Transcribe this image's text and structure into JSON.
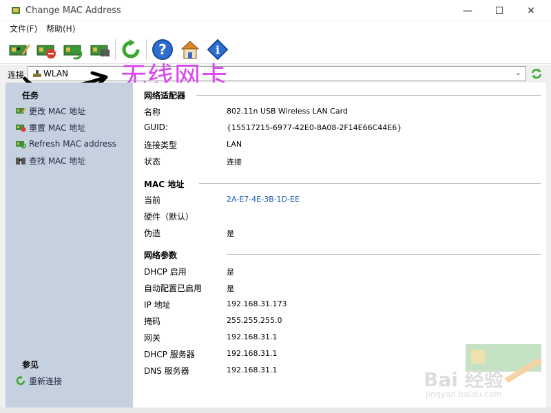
{
  "window": {
    "title": "Change MAC Address",
    "minimize": "—",
    "maximize": "☐",
    "close": "✕"
  },
  "menu": {
    "file": "文件(F)",
    "help": "帮助(H)"
  },
  "connection": {
    "label": "连接",
    "value": "WLAN",
    "chevron": "⌄"
  },
  "annotation": {
    "text": "无线网卡"
  },
  "sidebar": {
    "tasks_heading": "任务",
    "tasks": [
      {
        "label": "更改 MAC 地址"
      },
      {
        "label": "重置 MAC 地址"
      },
      {
        "label": "Refresh MAC address"
      },
      {
        "label": "查找 MAC 地址"
      }
    ],
    "see_also_heading": "参见",
    "see_also": [
      {
        "label": "重新连接"
      }
    ]
  },
  "adapter": {
    "heading": "网络适配器",
    "rows": [
      {
        "label": "名称",
        "value": "802.11n USB Wireless LAN Card"
      },
      {
        "label": "GUID:",
        "value": "{15517215-6977-42E0-8A08-2F14E66C44E6}"
      },
      {
        "label": "连接类型",
        "value": "LAN"
      },
      {
        "label": "状态",
        "value": "连接"
      }
    ]
  },
  "mac": {
    "heading": "MAC 地址",
    "rows": [
      {
        "label": "当前",
        "value": "2A-E7-4E-3B-1D-EE"
      },
      {
        "label": "硬件（默认）",
        "value": ""
      },
      {
        "label": "伪造",
        "value": "是"
      }
    ]
  },
  "netparams": {
    "heading": "网络参数",
    "rows": [
      {
        "label": "DHCP 启用",
        "value": "是"
      },
      {
        "label": "自动配置已启用",
        "value": "是"
      },
      {
        "label": "IP 地址",
        "value": "192.168.31.173"
      },
      {
        "label": "掩码",
        "value": "255.255.255.0"
      },
      {
        "label": "网关",
        "value": "192.168.31.1"
      },
      {
        "label": "DHCP 服务器",
        "value": "192.168.31.1"
      },
      {
        "label": "DNS 服务器",
        "value": "192.168.31.1"
      }
    ]
  },
  "watermark": {
    "text": "Bai 经验",
    "url": "jingyan.baidu.com"
  },
  "colors": {
    "sidebar_bg": "#c5d1df",
    "annotation": "#d946ef",
    "link": "#1d5fb4"
  }
}
